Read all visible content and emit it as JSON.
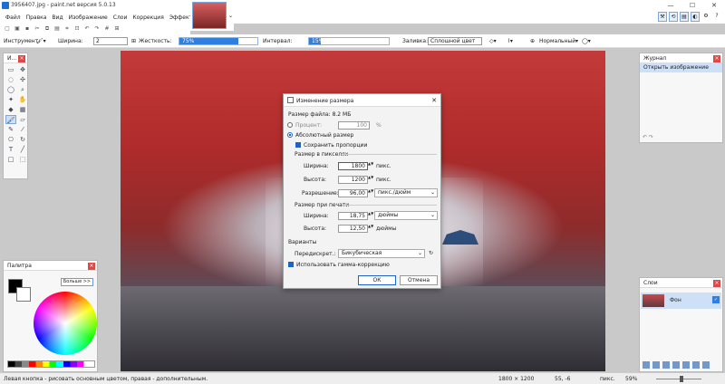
{
  "window": {
    "title": "3956407.jpg - paint.net версия 5.0.13",
    "minimize": "—",
    "maximize": "☐",
    "close": "✕"
  },
  "menu": [
    "Файл",
    "Правка",
    "Вид",
    "Изображение",
    "Слои",
    "Коррекция",
    "Эффекты"
  ],
  "toolbar_options": {
    "tool_label": "Инструмент:",
    "width_label": "Ширина:",
    "width_value": "2",
    "hardness_label": "Жесткость:",
    "hardness_value": "75%",
    "hardness_fraction": 0.75,
    "interval_label": "Интервал:",
    "interval_value": "15%",
    "interval_fraction": 0.15,
    "fill_label": "Заливка:",
    "fill_value": "Сплошной цвет",
    "blend_value": "Нормальный"
  },
  "tools_panel": {
    "title": "И..."
  },
  "palette": {
    "title": "Палитра",
    "more_label": "Больше >>",
    "primary_color": "#000000",
    "secondary_color": "#ffffff"
  },
  "history": {
    "title": "Журнал",
    "items": [
      "Открыть изображение"
    ]
  },
  "layers": {
    "title": "Слои",
    "layer_name": "Фон"
  },
  "status": {
    "hint": "Левая кнопка - рисовать основным цветом, правая - дополнительным.",
    "image_size": "1800 × 1200",
    "coords": "55, -6",
    "units": "пикс.",
    "zoom": "59%"
  },
  "dialog": {
    "title": "Изменение размера",
    "file_size": "Размер файла: 8.2 МБ",
    "percent_label": "Процент:",
    "percent_value": "100",
    "percent_unit": "%",
    "absolute_label": "Абсолютный размер",
    "keep_ratio_label": "Сохранить пропорции",
    "pixels_section": "Размер в пикселях",
    "width_label": "Ширина:",
    "width_px": "1800",
    "width_px_unit": "пикс.",
    "height_label": "Высота:",
    "height_px": "1200",
    "height_px_unit": "пикс.",
    "resolution_label": "Разрешение:",
    "resolution_value": "96,00",
    "resolution_unit": "пикс./дюйм",
    "print_section": "Размер при печати",
    "print_width_label": "Ширина:",
    "print_width": "18,75",
    "print_width_unit": "дюймы",
    "print_height_label": "Высота:",
    "print_height": "12,50",
    "print_height_unit": "дюймы",
    "options_section": "Варианты",
    "resampling_label": "Передискрет.:",
    "resampling_value": "Бикубическая",
    "gamma_label": "Использовать гамма-коррекцию",
    "ok_label": "ОК",
    "cancel_label": "Отмена"
  }
}
